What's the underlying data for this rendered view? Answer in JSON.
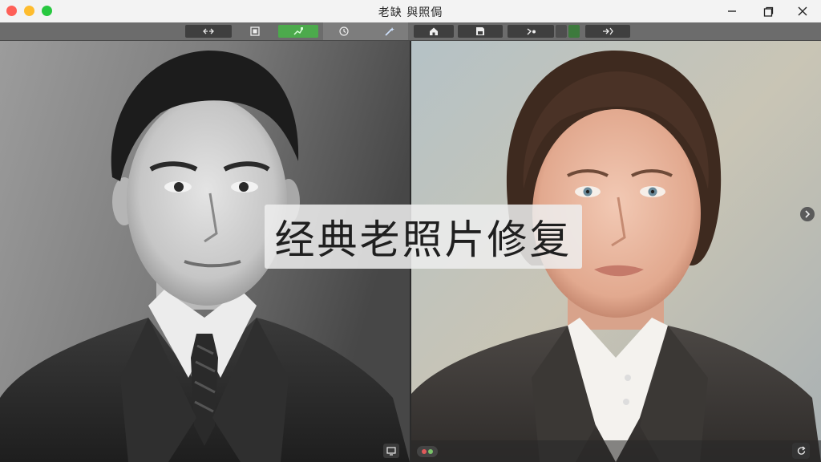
{
  "window": {
    "title": "老缺 與照侷"
  },
  "toolbar": {
    "buttons": [
      {
        "name": "compare-icon",
        "state": "normal"
      },
      {
        "name": "frame-icon",
        "state": "normal"
      },
      {
        "name": "colorize-icon",
        "state": "active"
      },
      {
        "name": "history-icon",
        "state": "normal"
      },
      {
        "name": "magic-wand-icon",
        "state": "normal"
      },
      {
        "name": "home-icon",
        "state": "normal"
      },
      {
        "name": "save-icon",
        "state": "normal"
      },
      {
        "name": "tools-icon",
        "state": "normal"
      },
      {
        "name": "next-icon",
        "state": "normal"
      }
    ],
    "accent_color": "#4caa4c"
  },
  "overlay": {
    "title": "经典老照片修复"
  },
  "colors": {
    "titlebar_bg": "#f3f3f3",
    "toolbar_bg": "#6c6c6c",
    "overlay_bg": "#eeeeee"
  }
}
